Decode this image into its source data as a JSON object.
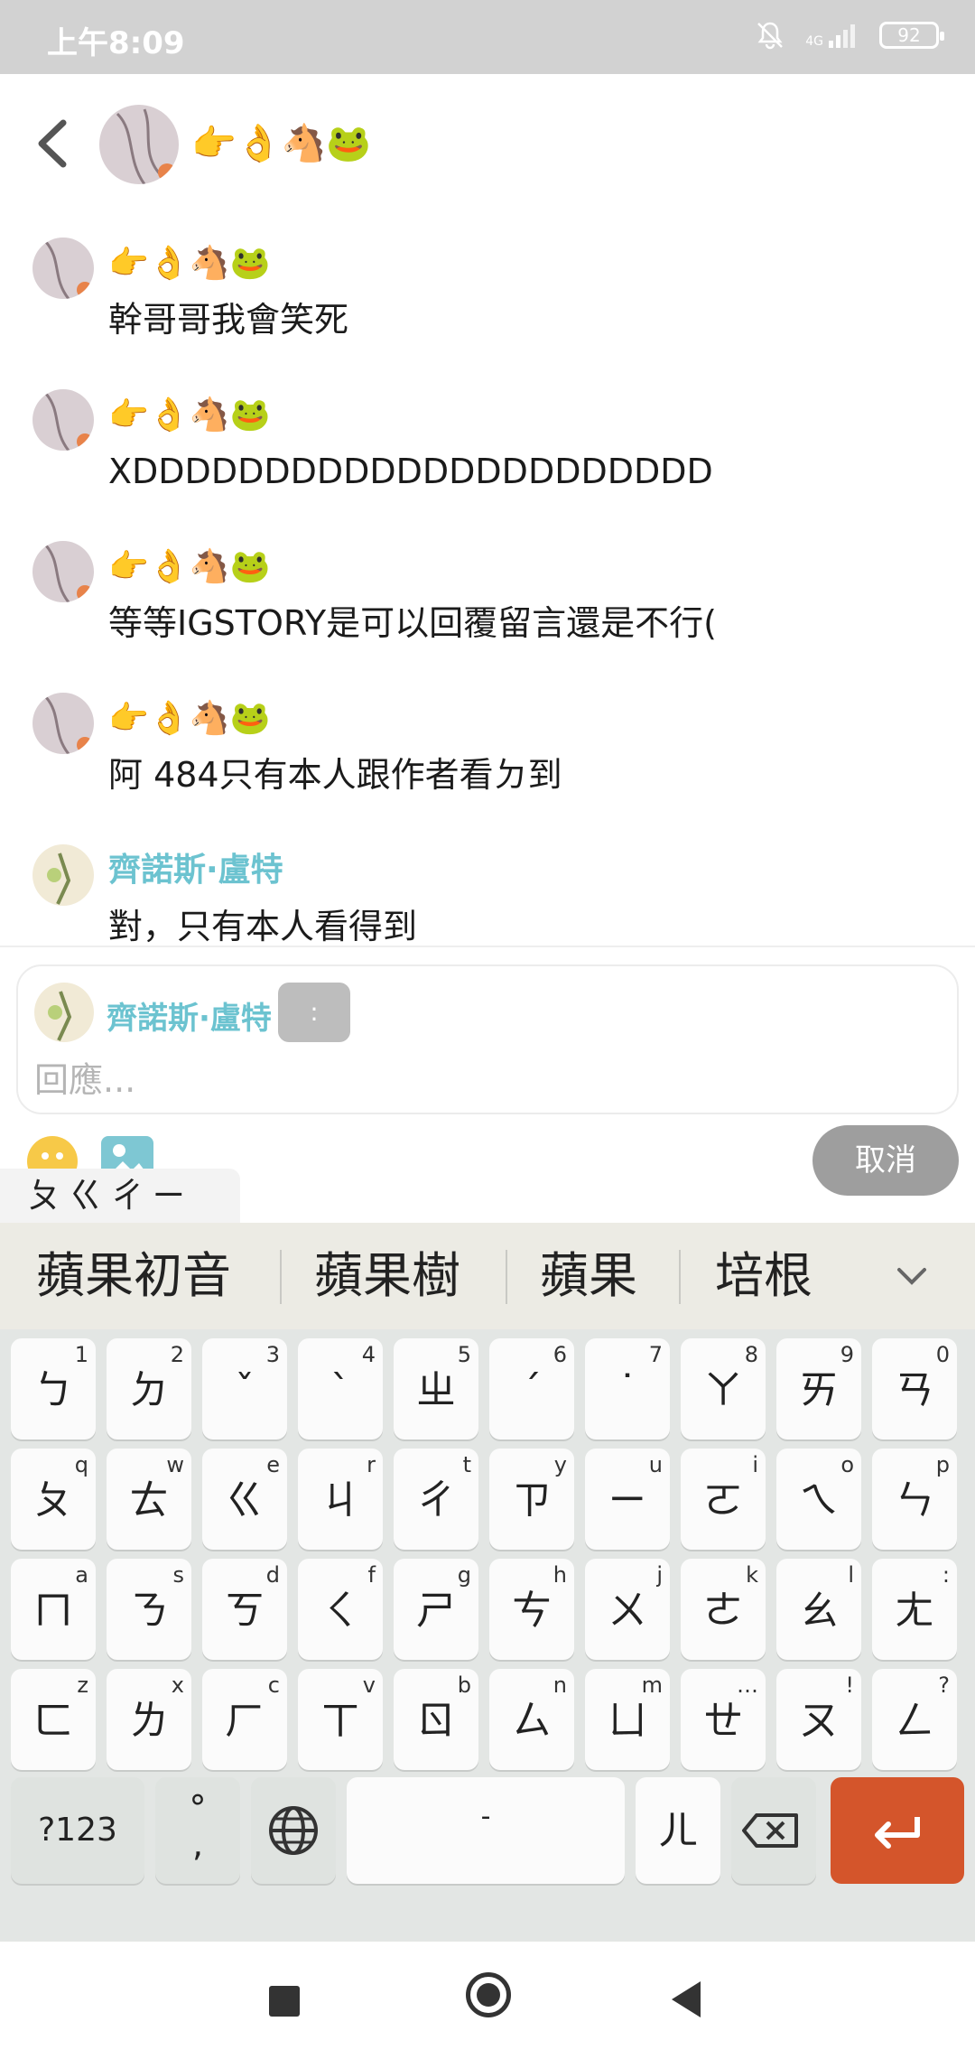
{
  "status_bar": {
    "time": "上午8:09",
    "network": "4G",
    "battery": "92"
  },
  "header": {
    "title": "👉👌🐴🐸"
  },
  "messages": [
    {
      "name": "👉👌🐴🐸",
      "text": "幹哥哥我會笑死",
      "name_style": "emoji"
    },
    {
      "name": "👉👌🐴🐸",
      "text": "XDDDDDDDDDDDDDDDDDDDDDD",
      "name_style": "emoji"
    },
    {
      "name": "👉👌🐴🐸",
      "text": "等等IGSTORY是可以回覆留言還是不行(",
      "name_style": "emoji"
    },
    {
      "name": "👉👌🐴🐸",
      "text": "阿 484只有本人跟作者看ㄉ到",
      "name_style": "emoji"
    },
    {
      "name": "齊諾斯·盧特",
      "text": "對，只有本人看得到",
      "name_style": "blue"
    }
  ],
  "reply": {
    "name": "齊諾斯·盧特",
    "tag": ":",
    "placeholder": "回應..."
  },
  "toolbar": {
    "cancel_label": "取消"
  },
  "ime": {
    "composition": "ㄆㄍㄔㄧ",
    "suggestions": [
      "蘋果初音",
      "蘋果樹",
      "蘋果",
      "培根"
    ],
    "rows": [
      [
        {
          "main": "ㄅ",
          "hint": "1"
        },
        {
          "main": "ㄉ",
          "hint": "2"
        },
        {
          "main": "ˇ",
          "hint": "3"
        },
        {
          "main": "ˋ",
          "hint": "4"
        },
        {
          "main": "ㄓ",
          "hint": "5"
        },
        {
          "main": "ˊ",
          "hint": "6"
        },
        {
          "main": "˙",
          "hint": "7"
        },
        {
          "main": "ㄚ",
          "hint": "8"
        },
        {
          "main": "ㄞ",
          "hint": "9"
        },
        {
          "main": "ㄢ",
          "hint": "0"
        }
      ],
      [
        {
          "main": "ㄆ",
          "hint": "q"
        },
        {
          "main": "ㄊ",
          "hint": "w"
        },
        {
          "main": "ㄍ",
          "hint": "e"
        },
        {
          "main": "ㄐ",
          "hint": "r"
        },
        {
          "main": "ㄔ",
          "hint": "t"
        },
        {
          "main": "ㄗ",
          "hint": "y"
        },
        {
          "main": "ㄧ",
          "hint": "u"
        },
        {
          "main": "ㄛ",
          "hint": "i"
        },
        {
          "main": "ㄟ",
          "hint": "o"
        },
        {
          "main": "ㄣ",
          "hint": "p"
        }
      ],
      [
        {
          "main": "ㄇ",
          "hint": "a"
        },
        {
          "main": "ㄋ",
          "hint": "s"
        },
        {
          "main": "ㄎ",
          "hint": "d"
        },
        {
          "main": "ㄑ",
          "hint": "f"
        },
        {
          "main": "ㄕ",
          "hint": "g"
        },
        {
          "main": "ㄘ",
          "hint": "h"
        },
        {
          "main": "ㄨ",
          "hint": "j"
        },
        {
          "main": "ㄜ",
          "hint": "k"
        },
        {
          "main": "ㄠ",
          "hint": "l"
        },
        {
          "main": "ㄤ",
          "hint": ":"
        }
      ],
      [
        {
          "main": "ㄈ",
          "hint": "z"
        },
        {
          "main": "ㄌ",
          "hint": "x"
        },
        {
          "main": "ㄏ",
          "hint": "c"
        },
        {
          "main": "ㄒ",
          "hint": "v"
        },
        {
          "main": "ㄖ",
          "hint": "b"
        },
        {
          "main": "ㄙ",
          "hint": "n"
        },
        {
          "main": "ㄩ",
          "hint": "m"
        },
        {
          "main": "ㄝ",
          "hint": "…"
        },
        {
          "main": "ㄡ",
          "hint": "!"
        },
        {
          "main": "ㄥ",
          "hint": "?"
        }
      ]
    ],
    "bottom": {
      "mode": "?123",
      "punct": "°\n,",
      "space": "-",
      "er": "ㄦ"
    }
  },
  "colors": {
    "accent_blue": "#6cc3d0",
    "enter_key": "#d4552b",
    "cancel_button": "#9e9e9e"
  }
}
